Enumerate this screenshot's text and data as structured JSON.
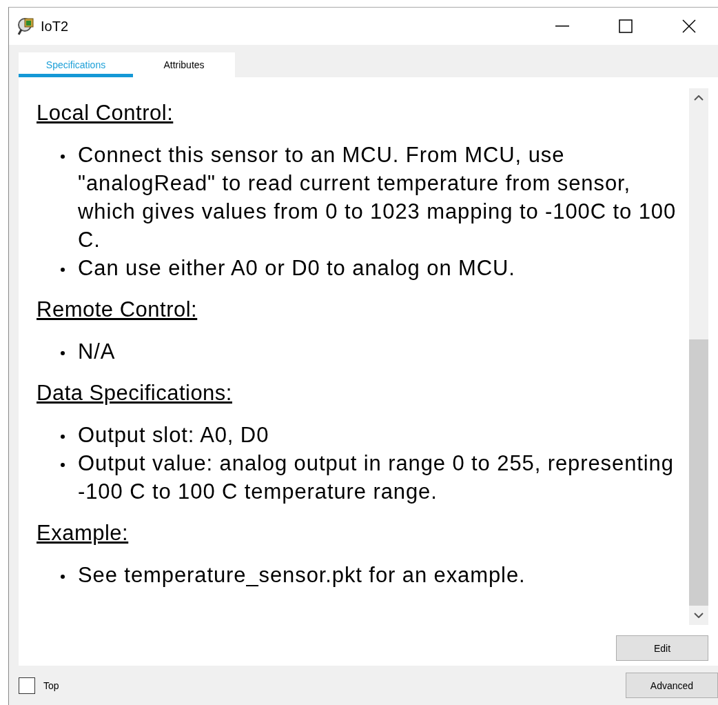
{
  "window": {
    "title": "IoT2"
  },
  "tabs": [
    {
      "label": "Specifications",
      "selected": true
    },
    {
      "label": "Attributes",
      "selected": false
    }
  ],
  "sections": [
    {
      "heading": "Local Control:",
      "bullets": [
        "Connect this sensor to an MCU. From MCU, use \"analogRead\" to read current temperature from sensor, which gives values from 0 to 1023 mapping to -100C to 100 C.",
        "Can use either A0 or D0 to analog on MCU."
      ]
    },
    {
      "heading": "Remote Control:",
      "bullets": [
        "N/A"
      ]
    },
    {
      "heading": "Data Specifications:",
      "bullets": [
        "Output slot: A0, D0",
        "Output value: analog output in range 0 to 255, representing -100 C to 100 C temperature range."
      ]
    },
    {
      "heading": "Example:",
      "bullets": [
        "See temperature_sensor.pkt for an example."
      ]
    }
  ],
  "edit_button": "Edit",
  "top_checkbox": {
    "label": "Top",
    "checked": false
  },
  "advanced_button": "Advanced"
}
